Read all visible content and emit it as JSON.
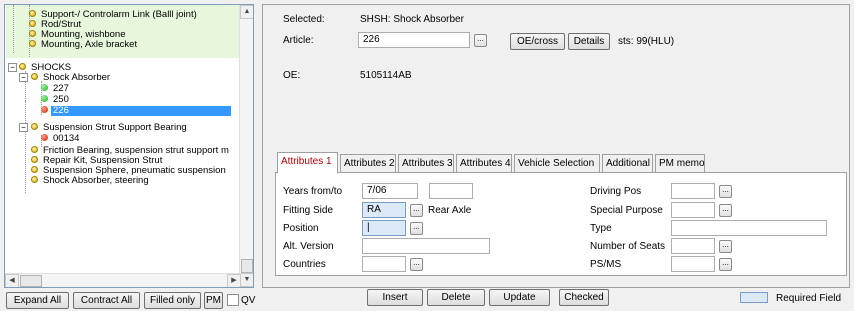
{
  "tree": {
    "nodes": [
      {
        "label": "Support-/ Controlarm Link (Balll joint)",
        "icon": "yellow"
      },
      {
        "label": "Rod/Strut",
        "icon": "yellow"
      },
      {
        "label": "Mounting, wishbone",
        "icon": "yellow"
      },
      {
        "label": "Mounting, Axle bracket",
        "icon": "yellow"
      },
      {
        "label": "SHOCKS",
        "icon": "yellow"
      },
      {
        "label": "Shock Absorber",
        "icon": "yellow"
      },
      {
        "label": "227",
        "icon": "green"
      },
      {
        "label": "250",
        "icon": "green"
      },
      {
        "label": "226",
        "icon": "red"
      },
      {
        "label": "Suspension Strut Support Bearing",
        "icon": "yellow"
      },
      {
        "label": "00134",
        "icon": "red"
      },
      {
        "label": "Friction Bearing, suspension strut support m",
        "icon": "yellow"
      },
      {
        "label": "Repair Kit, Suspension Strut",
        "icon": "yellow"
      },
      {
        "label": "Suspension Sphere, pneumatic suspension",
        "icon": "yellow"
      },
      {
        "label": "Shock Absorber, steering",
        "icon": "yellow"
      }
    ],
    "expand_glyph": "+",
    "collapse_glyph": "−"
  },
  "bottom_left": {
    "expand_all": "Expand All",
    "contract_all": "Contract All",
    "filled_only": "Filled only",
    "pm": "PM",
    "qv": "QV"
  },
  "header": {
    "selected_label": "Selected:",
    "selected_value": "SHSH: Shock Absorber",
    "article_label": "Article:",
    "article_value": "226",
    "oe_cross": "OE/cross",
    "details": "Details",
    "status": "sts: 99(HLU)",
    "oe_label": "OE:",
    "oe_value": "5105114AB",
    "ellipsis": "..."
  },
  "tabs": [
    "Attributes 1",
    "Attributes 2",
    "Attributes 3",
    "Attributes 4",
    "Vehicle Selection",
    "Additional",
    "PM memo"
  ],
  "attributes": {
    "years_label": "Years from/to",
    "years_from": "7/06",
    "years_to": "",
    "fitting_side_label": "Fitting Side",
    "fitting_side_value": "RA",
    "fitting_side_desc": "Rear Axle",
    "position_label": "Position",
    "position_value": "|",
    "alt_version_label": "Alt. Version",
    "alt_version_value": "",
    "countries_label": "Countries",
    "countries_value": "",
    "driving_pos_label": "Driving Pos",
    "special_purpose_label": "Special Purpose",
    "type_label": "Type",
    "seats_label": "Number of Seats",
    "psms_label": "PS/MS"
  },
  "actions": {
    "insert": "Insert",
    "delete": "Delete",
    "update": "Update",
    "checked": "Checked",
    "required_field": "Required Field"
  },
  "colors": {
    "required_field_bg": "#dceaf8",
    "active_tab_text": "#b00000",
    "selection_bg": "#3399ff",
    "tree_highlight": "#e6f7dc"
  }
}
